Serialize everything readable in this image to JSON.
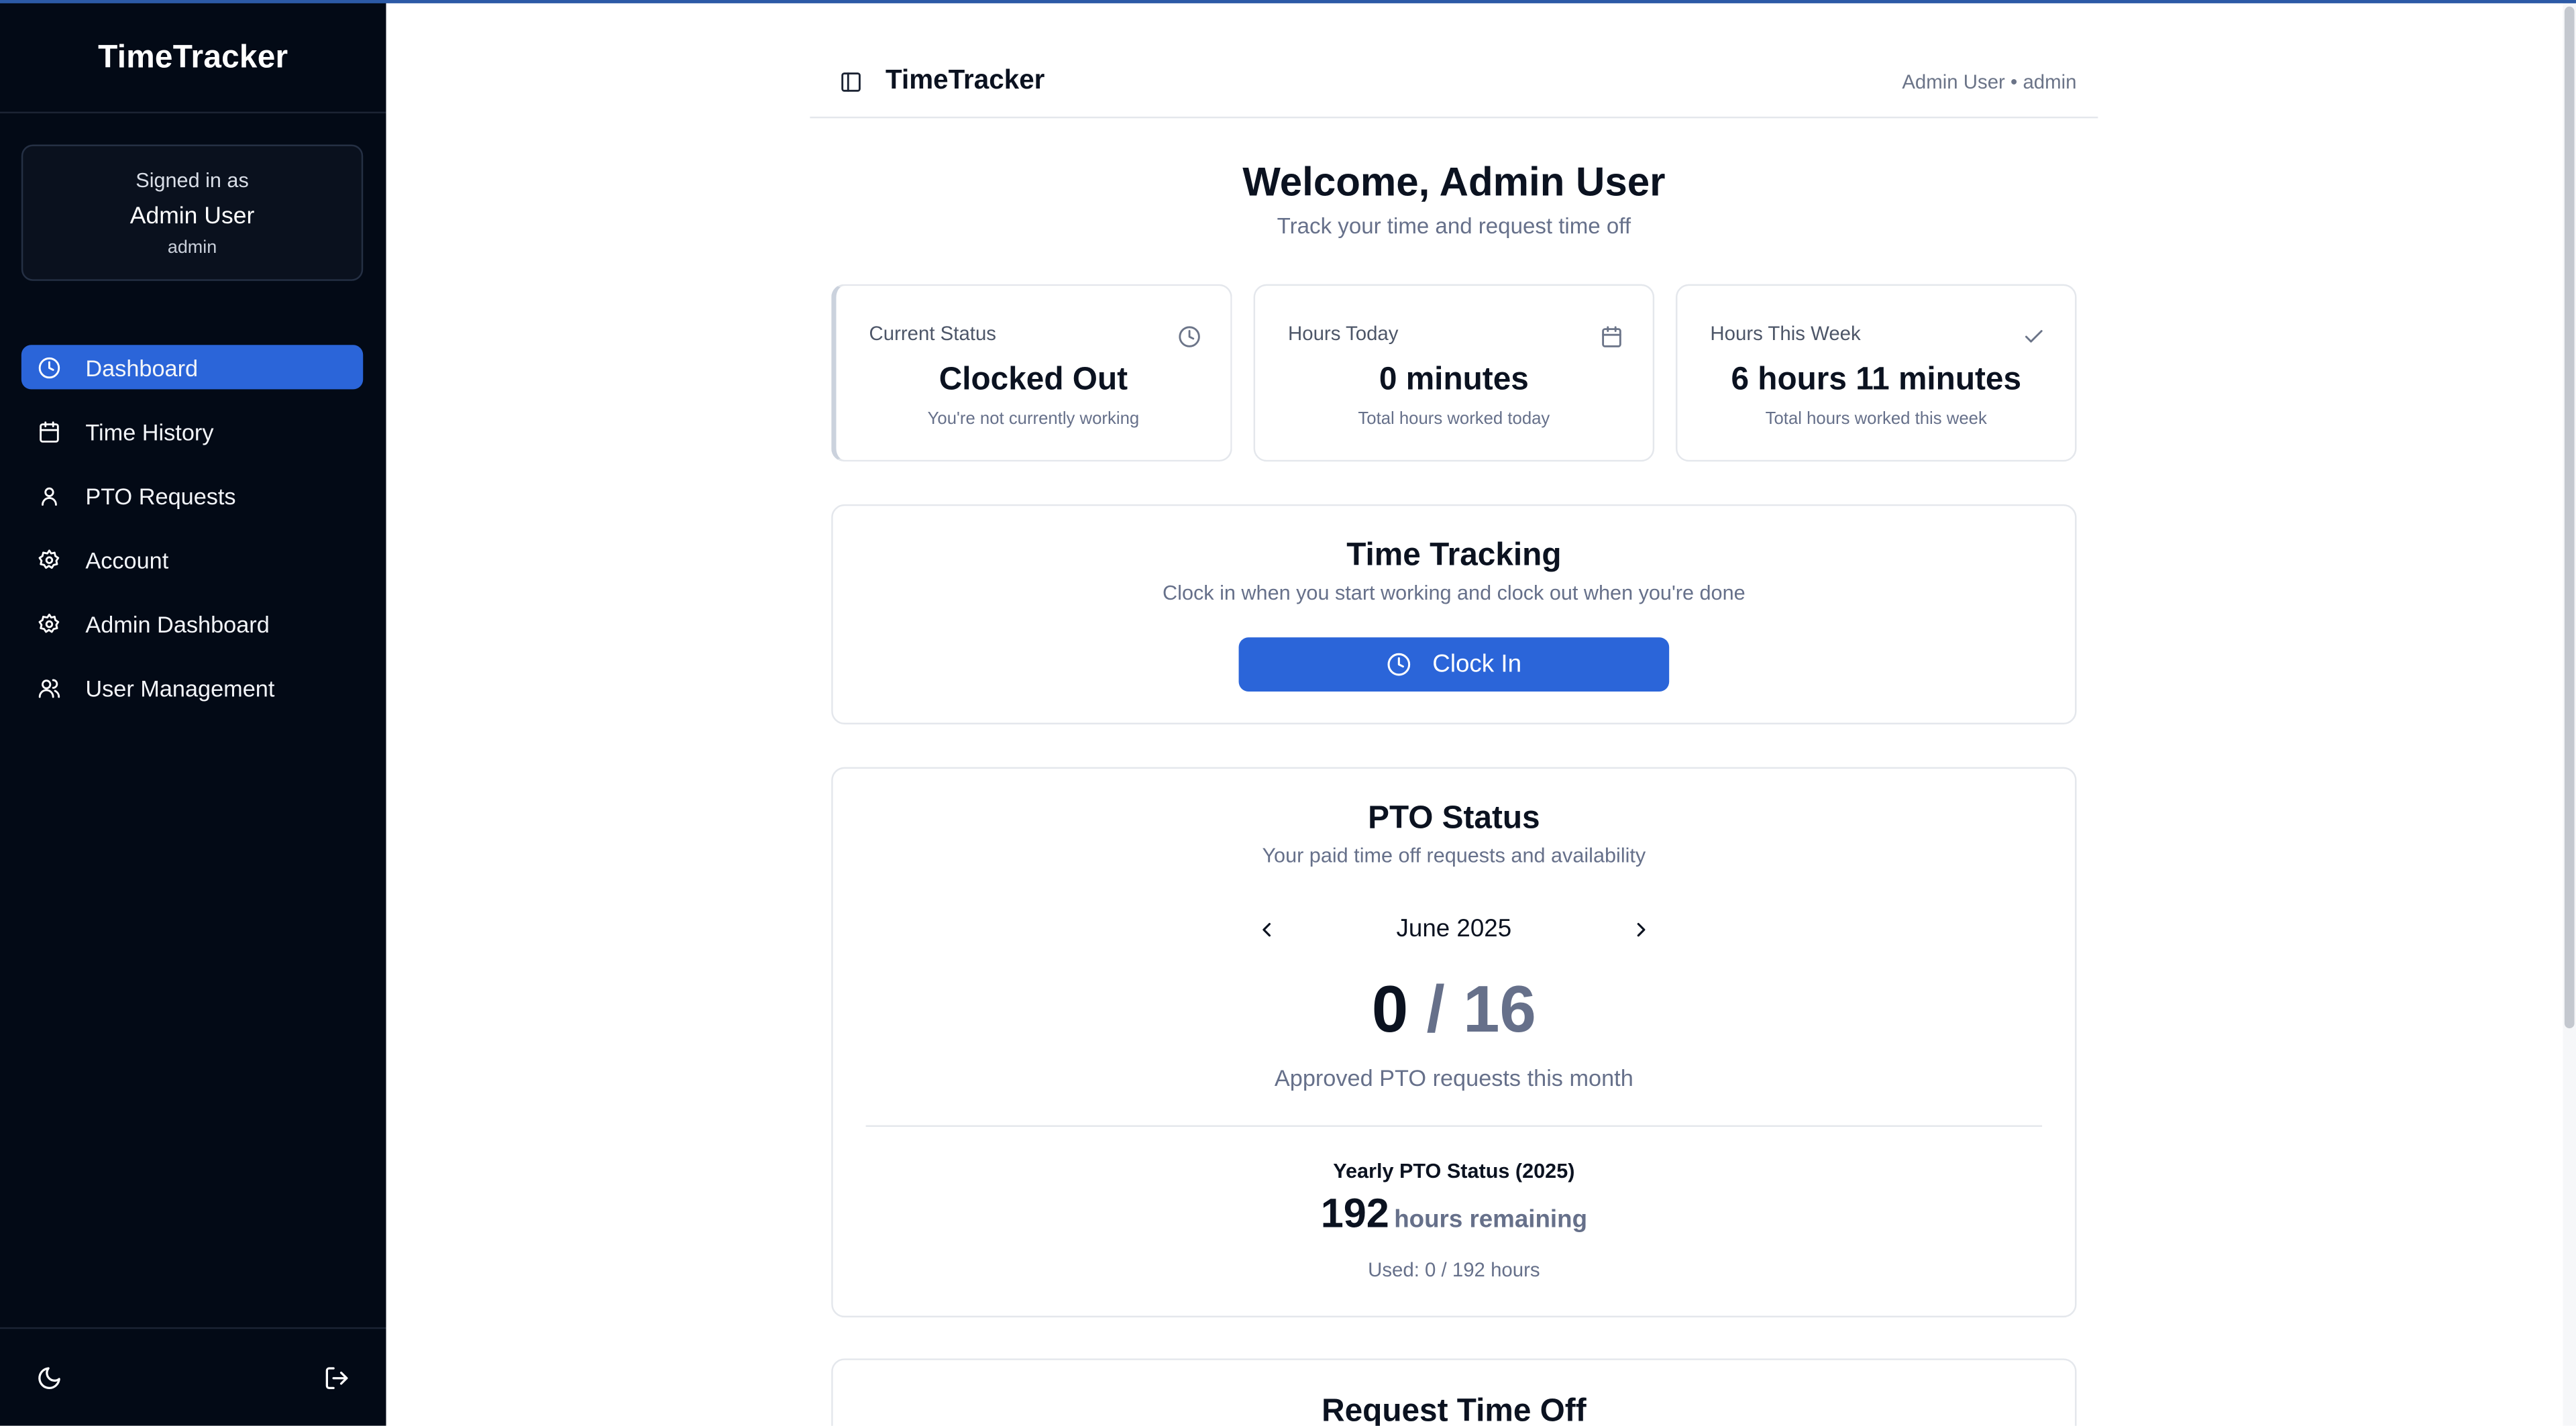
{
  "sidebar": {
    "brand": "TimeTracker",
    "signed_in": {
      "label": "Signed in as",
      "name": "Admin User",
      "role": "admin"
    },
    "items": [
      {
        "label": "Dashboard",
        "icon": "clock-icon",
        "active": true
      },
      {
        "label": "Time History",
        "icon": "calendar-icon"
      },
      {
        "label": "PTO Requests",
        "icon": "user-icon"
      },
      {
        "label": "Account",
        "icon": "settings-icon"
      },
      {
        "label": "Admin Dashboard",
        "icon": "settings-icon"
      },
      {
        "label": "User Management",
        "icon": "users-icon"
      }
    ],
    "footer_icons": [
      "moon-icon",
      "logout-icon"
    ]
  },
  "header": {
    "title": "TimeTracker",
    "user": "Admin User • admin"
  },
  "welcome": {
    "title": "Welcome, Admin User",
    "subtitle": "Track your time and request time off"
  },
  "stats": [
    {
      "label": "Current Status",
      "value": "Clocked Out",
      "sub": "You're not currently working",
      "icon": "clock-icon"
    },
    {
      "label": "Hours Today",
      "value": "0 minutes",
      "sub": "Total hours worked today",
      "icon": "calendar-icon"
    },
    {
      "label": "Hours This Week",
      "value": "6 hours 11 minutes",
      "sub": "Total hours worked this week",
      "icon": "check-icon"
    }
  ],
  "time_tracking": {
    "title": "Time Tracking",
    "subtitle": "Clock in when you start working and clock out when you're done",
    "button": "Clock In"
  },
  "pto_status": {
    "title": "PTO Status",
    "subtitle": "Your paid time off requests and availability",
    "month": "June 2025",
    "approved": "0",
    "separator": " / ",
    "total": "16",
    "caption": "Approved PTO requests this month",
    "yearly_title": "Yearly PTO Status (2025)",
    "hours_remaining": "192",
    "hours_remaining_label": "hours remaining",
    "used": "Used: 0 / 192 hours"
  },
  "request_time_off": {
    "title": "Request Time Off"
  },
  "colors": {
    "sidebar_bg": "#030a16",
    "accent": "#2b65d9",
    "muted_text": "#66708a"
  }
}
